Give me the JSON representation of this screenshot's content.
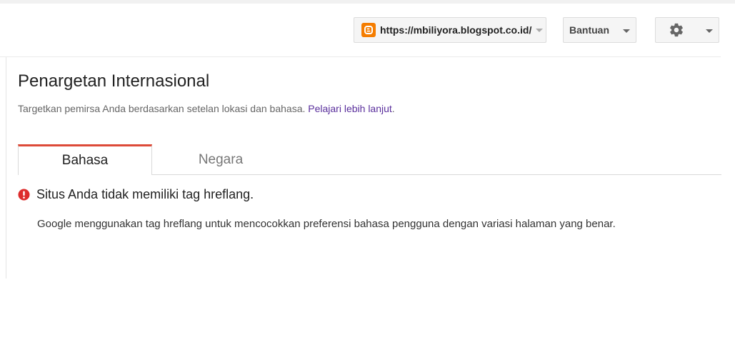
{
  "header": {
    "site_url": "https://mbiliyora.blogspot.co.id/",
    "help_label": "Bantuan",
    "icons": {
      "site": "blogger-icon",
      "settings": "gear-icon"
    }
  },
  "page": {
    "title": "Penargetan Internasional",
    "subtitle_text": "Targetkan pemirsa Anda berdasarkan setelan lokasi dan bahasa.",
    "learn_more_label": "Pelajari lebih lanjut",
    "subtitle_end": "."
  },
  "tabs": [
    {
      "label": "Bahasa",
      "active": true
    },
    {
      "label": "Negara",
      "active": false
    }
  ],
  "alert": {
    "title": "Situs Anda tidak memiliki tag hreflang.",
    "description": "Google menggunakan tag hreflang untuk mencocokkan preferensi bahasa pengguna dengan variasi halaman yang benar.",
    "icon": "error-icon"
  },
  "colors": {
    "accent_tab": "#dd4b39",
    "link": "#5a2f9c",
    "error": "#dd2c2c",
    "blogger": "#f57d00"
  }
}
